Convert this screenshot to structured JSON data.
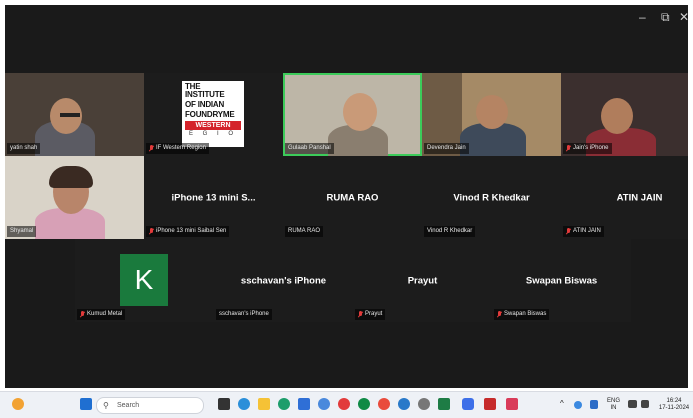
{
  "window_controls": {
    "minimize": "–",
    "restore": "⧉",
    "close": "✕"
  },
  "participants_row1": [
    {
      "name": "yatin shah",
      "muted": false
    },
    {
      "name": "IF Western Region",
      "muted": true
    },
    {
      "name": "Gulaab Panshal",
      "muted": false
    },
    {
      "name": "Devendra Jain",
      "muted": false
    },
    {
      "name": "Jain's iPhone",
      "muted": true
    }
  ],
  "logo": {
    "line1": "THE INSTITUTE",
    "line2": "OF INDIAN",
    "line3": "FOUNDRYME",
    "band": "WESTERN",
    "letters": "E G I O"
  },
  "participants_row2": [
    {
      "name": "Shyamal",
      "muted": false
    },
    {
      "display": "iPhone 13 mini S...",
      "name": "iPhone 13 mini Saibal Sen",
      "muted": true
    },
    {
      "display": "RUMA RAO",
      "name": "RUMA RAO",
      "muted": false
    },
    {
      "display": "Vinod R Khedkar",
      "name": "Vinod R Khedkar",
      "muted": false
    },
    {
      "display": "ATIN JAIN",
      "name": "ATIN JAIN",
      "muted": true
    }
  ],
  "participants_row3": [
    {
      "avatar_letter": "K",
      "name": "Kumud Metal",
      "muted": true
    },
    {
      "display": "sschavan's iPhone",
      "name": "sschavan's iPhone",
      "muted": false
    },
    {
      "display": "Prayut",
      "name": "Prayut",
      "muted": true
    },
    {
      "display": "Swapan Biswas",
      "name": "Swapan Biswas",
      "muted": true
    }
  ],
  "taskbar": {
    "search_placeholder": "Search",
    "lang": "ENG",
    "region": "IN",
    "time": "16:24",
    "date": "17-11-2024"
  },
  "colors": {
    "active_speaker": "#3ccb5a",
    "muted_mic": "#e23b3b",
    "avatar_bg": "#1a7a3d"
  }
}
